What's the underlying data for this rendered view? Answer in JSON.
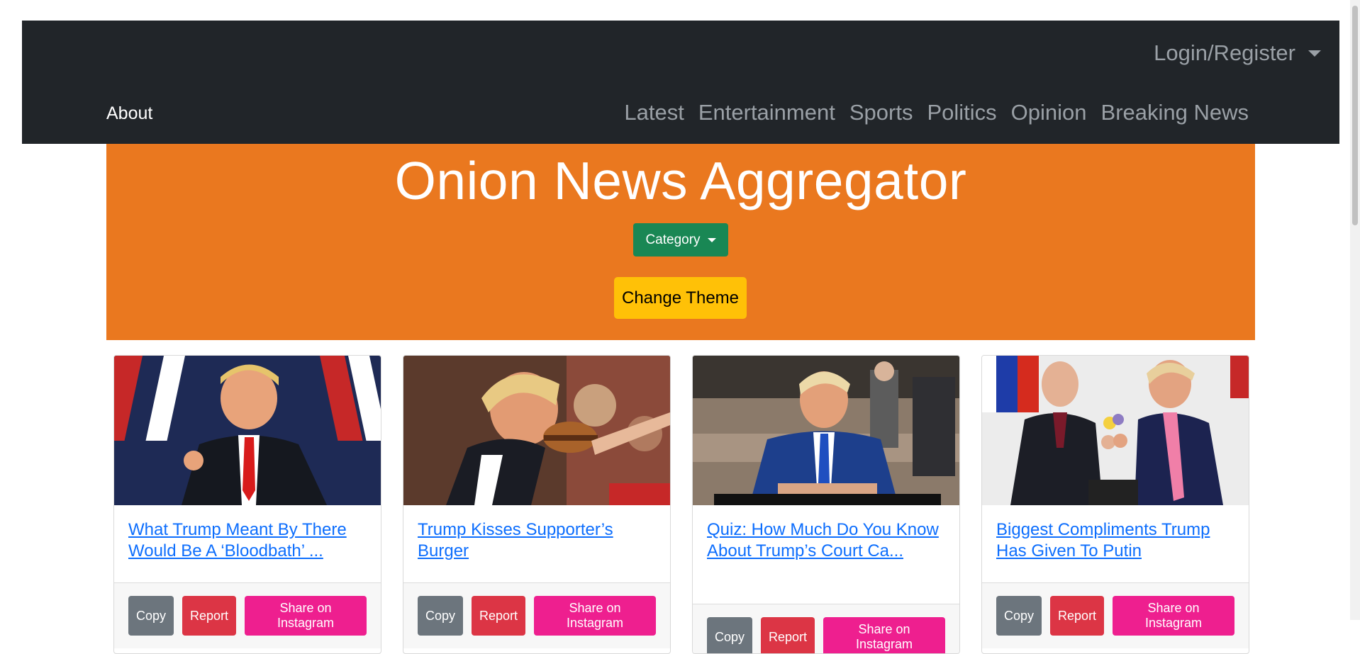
{
  "navbar": {
    "login_label": "Login/Register",
    "about_label": "About",
    "links": [
      "Latest",
      "Entertainment",
      "Sports",
      "Politics",
      "Opinion",
      "Breaking News"
    ]
  },
  "hero": {
    "title": "Onion News Aggregator",
    "category_label": "Category",
    "theme_label": "Change Theme"
  },
  "cards": [
    {
      "title": "What Trump Meant By There Would Be A ‘Bloodbath’ ...",
      "image_desc": "trump-speaking-photo"
    },
    {
      "title": "Trump Kisses Supporter’s Burger",
      "image_desc": "trump-burger-photo"
    },
    {
      "title": "Quiz: How Much Do You Know About Trump’s Court Ca...",
      "image_desc": "trump-court-photo"
    },
    {
      "title": "Biggest Compliments Trump Has Given To Putin",
      "image_desc": "trump-putin-photo"
    }
  ],
  "card_actions": {
    "copy_label": "Copy",
    "report_label": "Report",
    "share_label": "Share on Instagram"
  },
  "colors": {
    "navbar_bg": "#212529",
    "hero_bg": "#ea781f",
    "category_btn": "#198754",
    "theme_btn": "#ffc107",
    "link": "#0d6efd",
    "copy_btn": "#6c757d",
    "report_btn": "#dc3545",
    "share_btn": "#ee1f8f"
  }
}
